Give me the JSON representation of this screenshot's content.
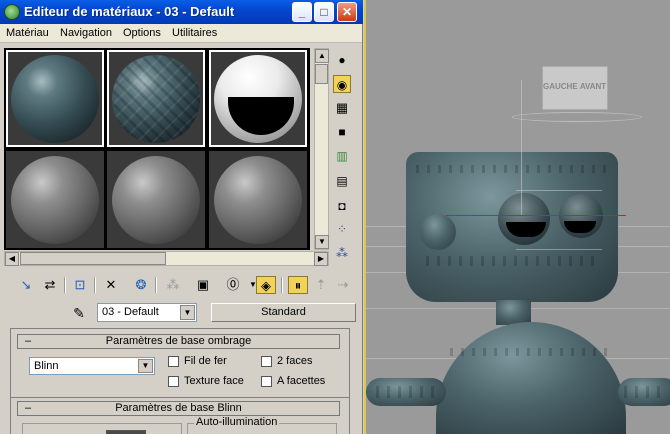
{
  "window": {
    "title": "Editeur de matériaux - 03 - Default",
    "buttons": {
      "minimize": "_",
      "maximize": "□",
      "close": "✕"
    }
  },
  "menu": [
    "Matériau",
    "Navigation",
    "Options",
    "Utilitaires"
  ],
  "material": {
    "name": "03 - Default",
    "type_button": "Standard"
  },
  "rollouts": {
    "shading_header": "Paramètres de base ombrage",
    "shader": "Blinn",
    "checkboxes": [
      {
        "label": "Fil de fer",
        "checked": false
      },
      {
        "label": "2 faces",
        "checked": false
      },
      {
        "label": "Texture face",
        "checked": false
      },
      {
        "label": "A facettes",
        "checked": false
      }
    ],
    "blinn_header": "Paramètres de base Blinn",
    "self_illum": "Auto-illumination"
  },
  "viewcube": {
    "left": "GAUCHE",
    "front": "AVANT"
  },
  "icons": {
    "right_tools": [
      "sample-type-icon",
      "backlight-icon",
      "background-checker-icon",
      "uv-tiling-icon",
      "video-color-check-icon",
      "make-preview-icon",
      "options-icon",
      "select-by-material-icon",
      "material-map-navigator-icon"
    ],
    "bottom_tools": [
      "get-material-icon",
      "put-to-scene-icon",
      "assign-to-selection-icon",
      "reset-map-icon",
      "make-copy-icon",
      "make-unique-icon",
      "put-to-library-icon",
      "material-id-channel-icon",
      "show-map-in-viewport-icon",
      "show-end-result-icon",
      "go-to-parent-icon",
      "go-forward-to-sibling-icon"
    ]
  },
  "colors": {
    "titlebar": "#0447cf",
    "active_tool": "#f2d35a",
    "viewport_bg": "#9a9a9a"
  }
}
